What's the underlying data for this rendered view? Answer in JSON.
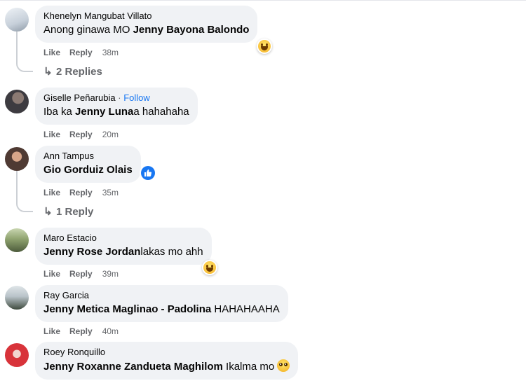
{
  "comments": [
    {
      "author": "Khenelyn Mangubat Villato",
      "text_prefix": "Anong ginawa MO ",
      "mention": "Jenny Bayona Balondo",
      "text_suffix": "",
      "like": "Like",
      "reply": "Reply",
      "time": "38m",
      "replies": "2 Replies",
      "avatar_colors": [
        "#dfe6ee",
        "#9aa7b5"
      ]
    },
    {
      "author": "Giselle Peñarubia",
      "follow": "Follow",
      "separator": "·",
      "text_prefix": "Iba ka ",
      "mention": "Jenny Luna",
      "text_suffix": "a hahahaha",
      "like": "Like",
      "reply": "Reply",
      "time": "20m",
      "avatar_colors": [
        "#3d3b40",
        "#8b7a73"
      ]
    },
    {
      "author": "Ann Tampus",
      "text_prefix": "",
      "mention": "Gio Gorduiz Olais",
      "text_suffix": "",
      "like": "Like",
      "reply": "Reply",
      "time": "35m",
      "replies": "1 Reply",
      "avatar_colors": [
        "#b07b63",
        "#4f3a33"
      ]
    },
    {
      "author": "Maro Estacio",
      "text_prefix": "",
      "mention": "Jenny Rose Jordan",
      "text_suffix": "lakas mo ahh",
      "like": "Like",
      "reply": "Reply",
      "time": "39m",
      "avatar_colors": [
        "#8fa36f",
        "#4c5a3b"
      ]
    },
    {
      "author": "Ray Garcia",
      "text_prefix": "",
      "mention": "Jenny Metica Maglinao - Padolina",
      "text_suffix": " HAHAHAAHA",
      "like": "Like",
      "reply": "Reply",
      "time": "40m",
      "avatar_colors": [
        "#b9c3c9",
        "#3e4a3d"
      ]
    },
    {
      "author": "Roey Ronquillo",
      "text_prefix": "",
      "mention": "Jenny Roxanne Zandueta Maghilom",
      "text_suffix": " Ikalma mo",
      "avatar_colors": [
        "#d8333a",
        "#f2d5cf"
      ]
    }
  ],
  "icons": {
    "reply_arrow": "reply-arrow-icon",
    "laugh": "laughing-emoji-icon",
    "like": "like-reaction-icon",
    "pleading": "pleading-emoji-icon"
  },
  "colors": {
    "bubble": "#f0f2f5",
    "link_blue": "#1877f2",
    "secondary_text": "#65676b"
  }
}
